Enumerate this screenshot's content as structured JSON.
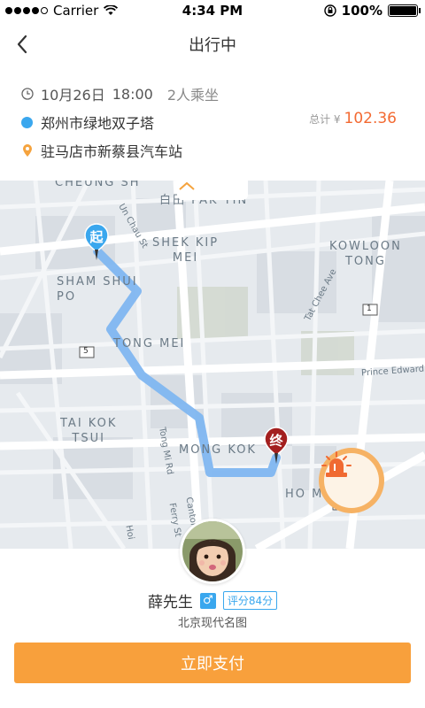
{
  "status_bar": {
    "carrier": "Carrier",
    "time": "4:34 PM",
    "battery": "100%"
  },
  "nav": {
    "title": "出行中"
  },
  "trip": {
    "date": "10月26日",
    "time": "18:00",
    "passengers": "2人乘坐",
    "origin": "郑州市绿地双子塔",
    "destination": "驻马店市新蔡县汽车站",
    "total_label": "总计 ¥",
    "total_amount": "102.36"
  },
  "map": {
    "start_marker": "起",
    "end_marker": "终",
    "labels": {
      "cheung_sha_wan": "CHEUNG SH",
      "pak_tin": "白田 PAK TIN",
      "shek_kip_mei": "SHEK KIP\nMEI",
      "kowloon_tong": "KOWLOON\nTONG",
      "sham_shui_po": "SHAM SHUI\nPO",
      "tong_mei": "TONG MEI",
      "tai_kok_tsui": "TAI KOK\nTSUI",
      "mong_kok": "MONG KOK",
      "ho_man": "HO M",
      "un_chau_st": "Un Chau St",
      "tai_chee_ave": "Tat Chee Ave",
      "prince_edward": "Prince Edward",
      "tong_mi_rd": "Tong Mi Rd",
      "canton": "Canton",
      "ferry_st": "Ferry St",
      "hoi": "Hoi",
      "route_1a": "1",
      "route_1b": "1",
      "route_5": "5",
      "route_1c": "1"
    }
  },
  "driver": {
    "name": "薛先生",
    "gender_symbol": "♂",
    "rating": "评分84分",
    "car": "北京现代名图"
  },
  "actions": {
    "pay_label": "立即支付"
  },
  "colors": {
    "accent": "#3aa7ee",
    "price": "#f36a32",
    "pay": "#f8a03c",
    "route": "#7fb6f0"
  }
}
